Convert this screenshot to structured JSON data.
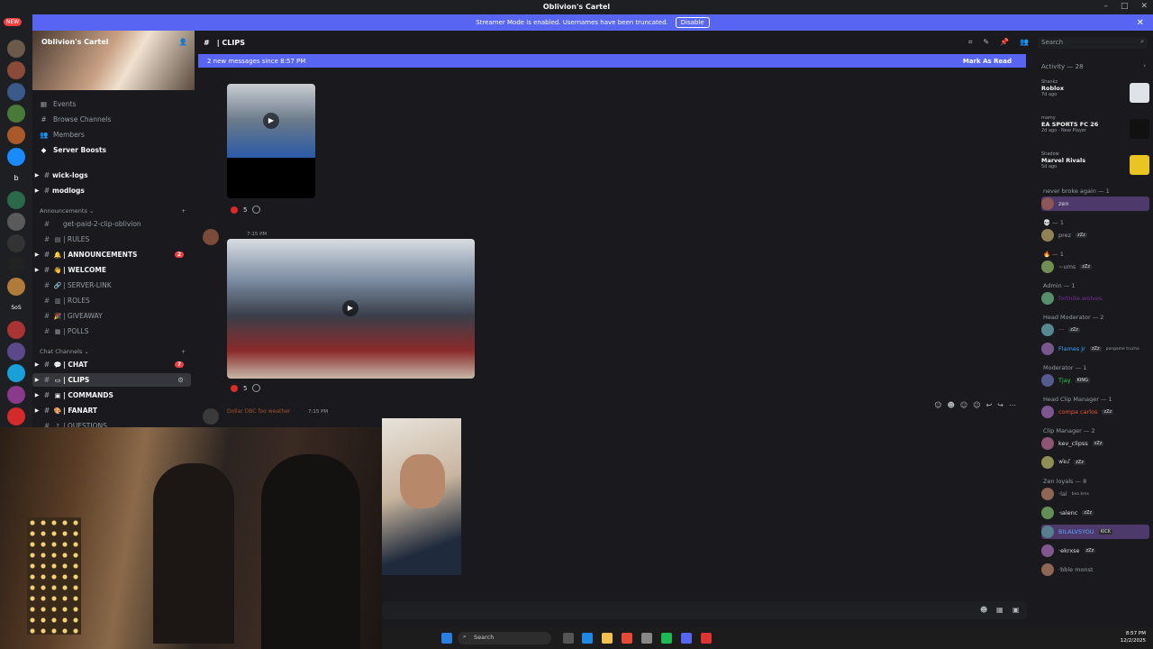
{
  "window": {
    "title": "Oblivion's Cartel",
    "controls": [
      "–",
      "□",
      "✕"
    ]
  },
  "banner": {
    "text": "Streamer Mode is enabled. Usernames have been truncated.",
    "button": "Disable",
    "close": "✕"
  },
  "server_rail": {
    "new_badge": "NEW",
    "labels": [
      "b",
      "SoS"
    ]
  },
  "server": {
    "name": "Oblivion's Cartel",
    "nav": [
      {
        "icon": "calendar-icon",
        "glyph": "▦",
        "label": "Events"
      },
      {
        "icon": "browse-icon",
        "glyph": "#",
        "label": "Browse Channels"
      },
      {
        "icon": "members-icon",
        "glyph": "👥",
        "label": "Members"
      },
      {
        "icon": "boost-icon",
        "glyph": "◆",
        "label": "Server Boosts"
      }
    ],
    "top_channels": [
      "wick-logs",
      "modlogs"
    ],
    "categories": {
      "announcements": "Announcements",
      "chat": "Chat Channels"
    },
    "announcement_channels": [
      {
        "name": "get-paid-2-clip-oblivion",
        "emoji": "",
        "bold": false
      },
      {
        "name": "| RULES",
        "emoji": "▤",
        "bold": false
      },
      {
        "name": "| ANNOUNCEMENTS",
        "emoji": "🔔",
        "bold": true,
        "badge": "2"
      },
      {
        "name": "| WELCOME",
        "emoji": "👋",
        "bold": true
      },
      {
        "name": "| SERVER-LINK",
        "emoji": "🔗",
        "bold": false
      },
      {
        "name": "| ROLES",
        "emoji": "▥",
        "bold": false
      },
      {
        "name": "| GIVEAWAY",
        "emoji": "🎉",
        "bold": false
      },
      {
        "name": "| POLLS",
        "emoji": "▦",
        "bold": false
      }
    ],
    "chat_channels": [
      {
        "name": "| CHAT",
        "emoji": "💬",
        "bold": true,
        "badge": "7"
      },
      {
        "name": "| CLIPS",
        "emoji": "▭",
        "bold": true,
        "selected": true
      },
      {
        "name": "| COMMANDS",
        "emoji": "▣",
        "bold": true
      },
      {
        "name": "| FANART",
        "emoji": "🎨",
        "bold": true
      },
      {
        "name": "| QUESTIONS",
        "emoji": "?",
        "bold": false
      }
    ]
  },
  "channel_header": {
    "name": "| CLIPS",
    "search_placeholder": "Search"
  },
  "new_messages": {
    "text": "2 new messages since 8:57 PM",
    "mark_read": "Mark As Read"
  },
  "messages": [
    {
      "reaction_count": "5"
    },
    {
      "time": "7:15 PM",
      "reaction_count": "5"
    },
    {
      "author": "Dollar DBC foo weather",
      "time": "7:15 PM"
    }
  ],
  "activity": {
    "header": "Activity — 28",
    "items": [
      {
        "user": "Shankz",
        "game": "Roblox",
        "time": "7d ago",
        "color": "#dfe3e8"
      },
      {
        "user": "mamy",
        "game": "EA SPORTS FC 26",
        "time": "2d ago · New Player",
        "color": "#111111"
      },
      {
        "user": "Shadow",
        "game": "Marvel Rivals",
        "time": "5d ago",
        "color": "#e8c521"
      }
    ]
  },
  "member_groups": [
    {
      "role": "never broke again — 1",
      "members": [
        {
          "name": "zen",
          "color": "#dbdee1",
          "highlight": true
        }
      ]
    },
    {
      "role": "💀 — 1",
      "members": [
        {
          "name": "prez",
          "color": "#949ba4",
          "tag": "zZz"
        }
      ]
    },
    {
      "role": "🔥 — 1",
      "members": [
        {
          "name": "~ums",
          "color": "#949ba4",
          "tag": "zZz"
        }
      ]
    },
    {
      "role": "Admin — 1",
      "members": [
        {
          "name": "fortnite.wolves",
          "color": "#7a2b9c"
        }
      ]
    },
    {
      "role": "Head Moderator — 2",
      "members": [
        {
          "name": "···",
          "color": "#949ba4",
          "tag": "zZz"
        },
        {
          "name": "Flames Jr",
          "color": "#3ba0ff",
          "tag": "zZz",
          "sub": "pongame trucha"
        }
      ]
    },
    {
      "role": "Moderator — 1",
      "members": [
        {
          "name": "Tjay",
          "color": "#2ec94a",
          "tag": "KING"
        }
      ]
    },
    {
      "role": "Head Clip Manager — 1",
      "members": [
        {
          "name": "compa carlos",
          "color": "#e8572a",
          "tag": "zZz"
        }
      ]
    },
    {
      "role": "Clip Manager — 2",
      "members": [
        {
          "name": "kev_clipss",
          "color": "#dbdee1",
          "tag": "zZz"
        },
        {
          "name": "ꪝꫀᦔ",
          "color": "#dbdee1",
          "tag": "zZz"
        }
      ]
    },
    {
      "role": "Zen loyals — 8",
      "members": [
        {
          "name": "·lal",
          "color": "#949ba4",
          "sub": "bea kms"
        },
        {
          "name": "·ıalenc",
          "color": "#dbdee1",
          "tag": "zZz"
        },
        {
          "name": "BILALVSYOU",
          "color": "#5ea0ff",
          "tag": "KICK",
          "highlight": true
        },
        {
          "name": "·ekrxse",
          "color": "#dbdee1",
          "tag": "zZz"
        },
        {
          "name": "·bble monst",
          "color": "#949ba4"
        }
      ]
    }
  ],
  "taskbar": {
    "search": "Search",
    "time": "8:57 PM",
    "date": "12/2/2025"
  },
  "colors": {
    "accent": "#5865f2",
    "danger": "#f23f42",
    "background": "#1a1a1e"
  }
}
